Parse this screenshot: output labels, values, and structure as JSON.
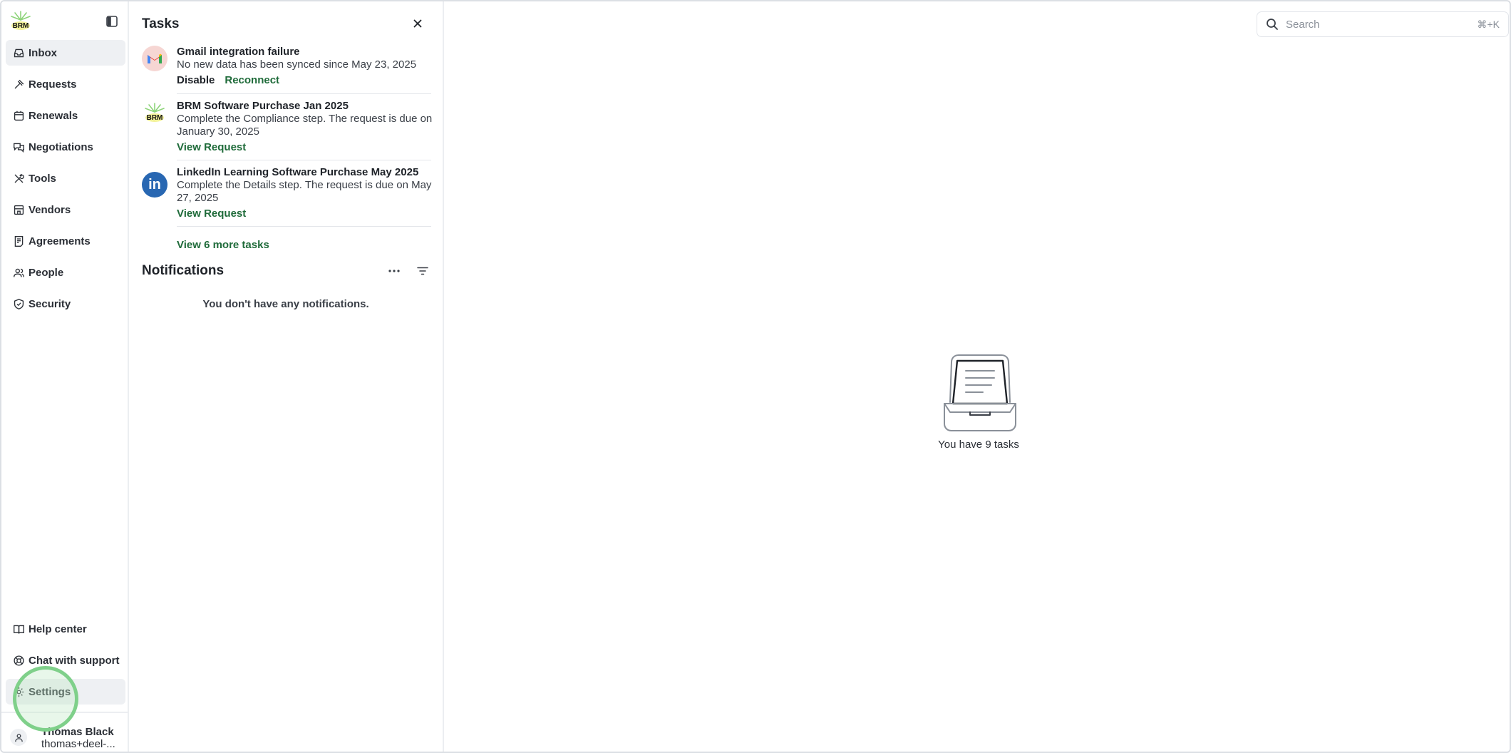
{
  "sidebar": {
    "logo_text": "BRM",
    "nav_items": [
      {
        "label": "Inbox",
        "icon": "inbox-icon",
        "active": true
      },
      {
        "label": "Requests",
        "icon": "gavel-icon"
      },
      {
        "label": "Renewals",
        "icon": "calendar-icon"
      },
      {
        "label": "Negotiations",
        "icon": "chat-bubbles-icon"
      },
      {
        "label": "Tools",
        "icon": "tools-icon"
      },
      {
        "label": "Vendors",
        "icon": "building-icon"
      },
      {
        "label": "Agreements",
        "icon": "document-icon"
      },
      {
        "label": "People",
        "icon": "people-icon"
      },
      {
        "label": "Security",
        "icon": "shield-icon"
      }
    ],
    "bottom_items": [
      {
        "label": "Help center",
        "icon": "book-icon"
      },
      {
        "label": "Chat with support",
        "icon": "lifebuoy-icon"
      },
      {
        "label": "Settings",
        "icon": "gear-icon",
        "active": true
      }
    ],
    "user": {
      "name": "Thomas Black",
      "email": "thomas+deel-..."
    }
  },
  "tasks_panel": {
    "title": "Tasks",
    "tasks": [
      {
        "icon": "gmail-icon",
        "title": "Gmail integration failure",
        "description": "No new data has been synced since May 23, 2025",
        "actions": [
          "Disable",
          "Reconnect"
        ]
      },
      {
        "icon": "brm-logo-icon",
        "icon_text": "BRM",
        "title": "BRM Software Purchase Jan 2025",
        "description": "Complete the Compliance step. The request is due on January 30, 2025",
        "actions": [
          "View Request"
        ]
      },
      {
        "icon": "linkedin-icon",
        "icon_text": "in",
        "title": "LinkedIn Learning Software Purchase May 2025",
        "description": "Complete the Details step. The request is due on May 27, 2025",
        "actions": [
          "View Request"
        ]
      }
    ],
    "more_tasks_label": "View 6 more tasks"
  },
  "notifications": {
    "title": "Notifications",
    "empty_text": "You don't have any notifications."
  },
  "main": {
    "search": {
      "placeholder": "Search",
      "shortcut": "⌘+K"
    },
    "empty_state_text": "You have 9 tasks"
  },
  "colors": {
    "accent_green": "#1f6b3a",
    "active_bg": "#eef0f3",
    "highlight_ring": "#7fd08a",
    "linkedin_blue": "#2867b2"
  }
}
